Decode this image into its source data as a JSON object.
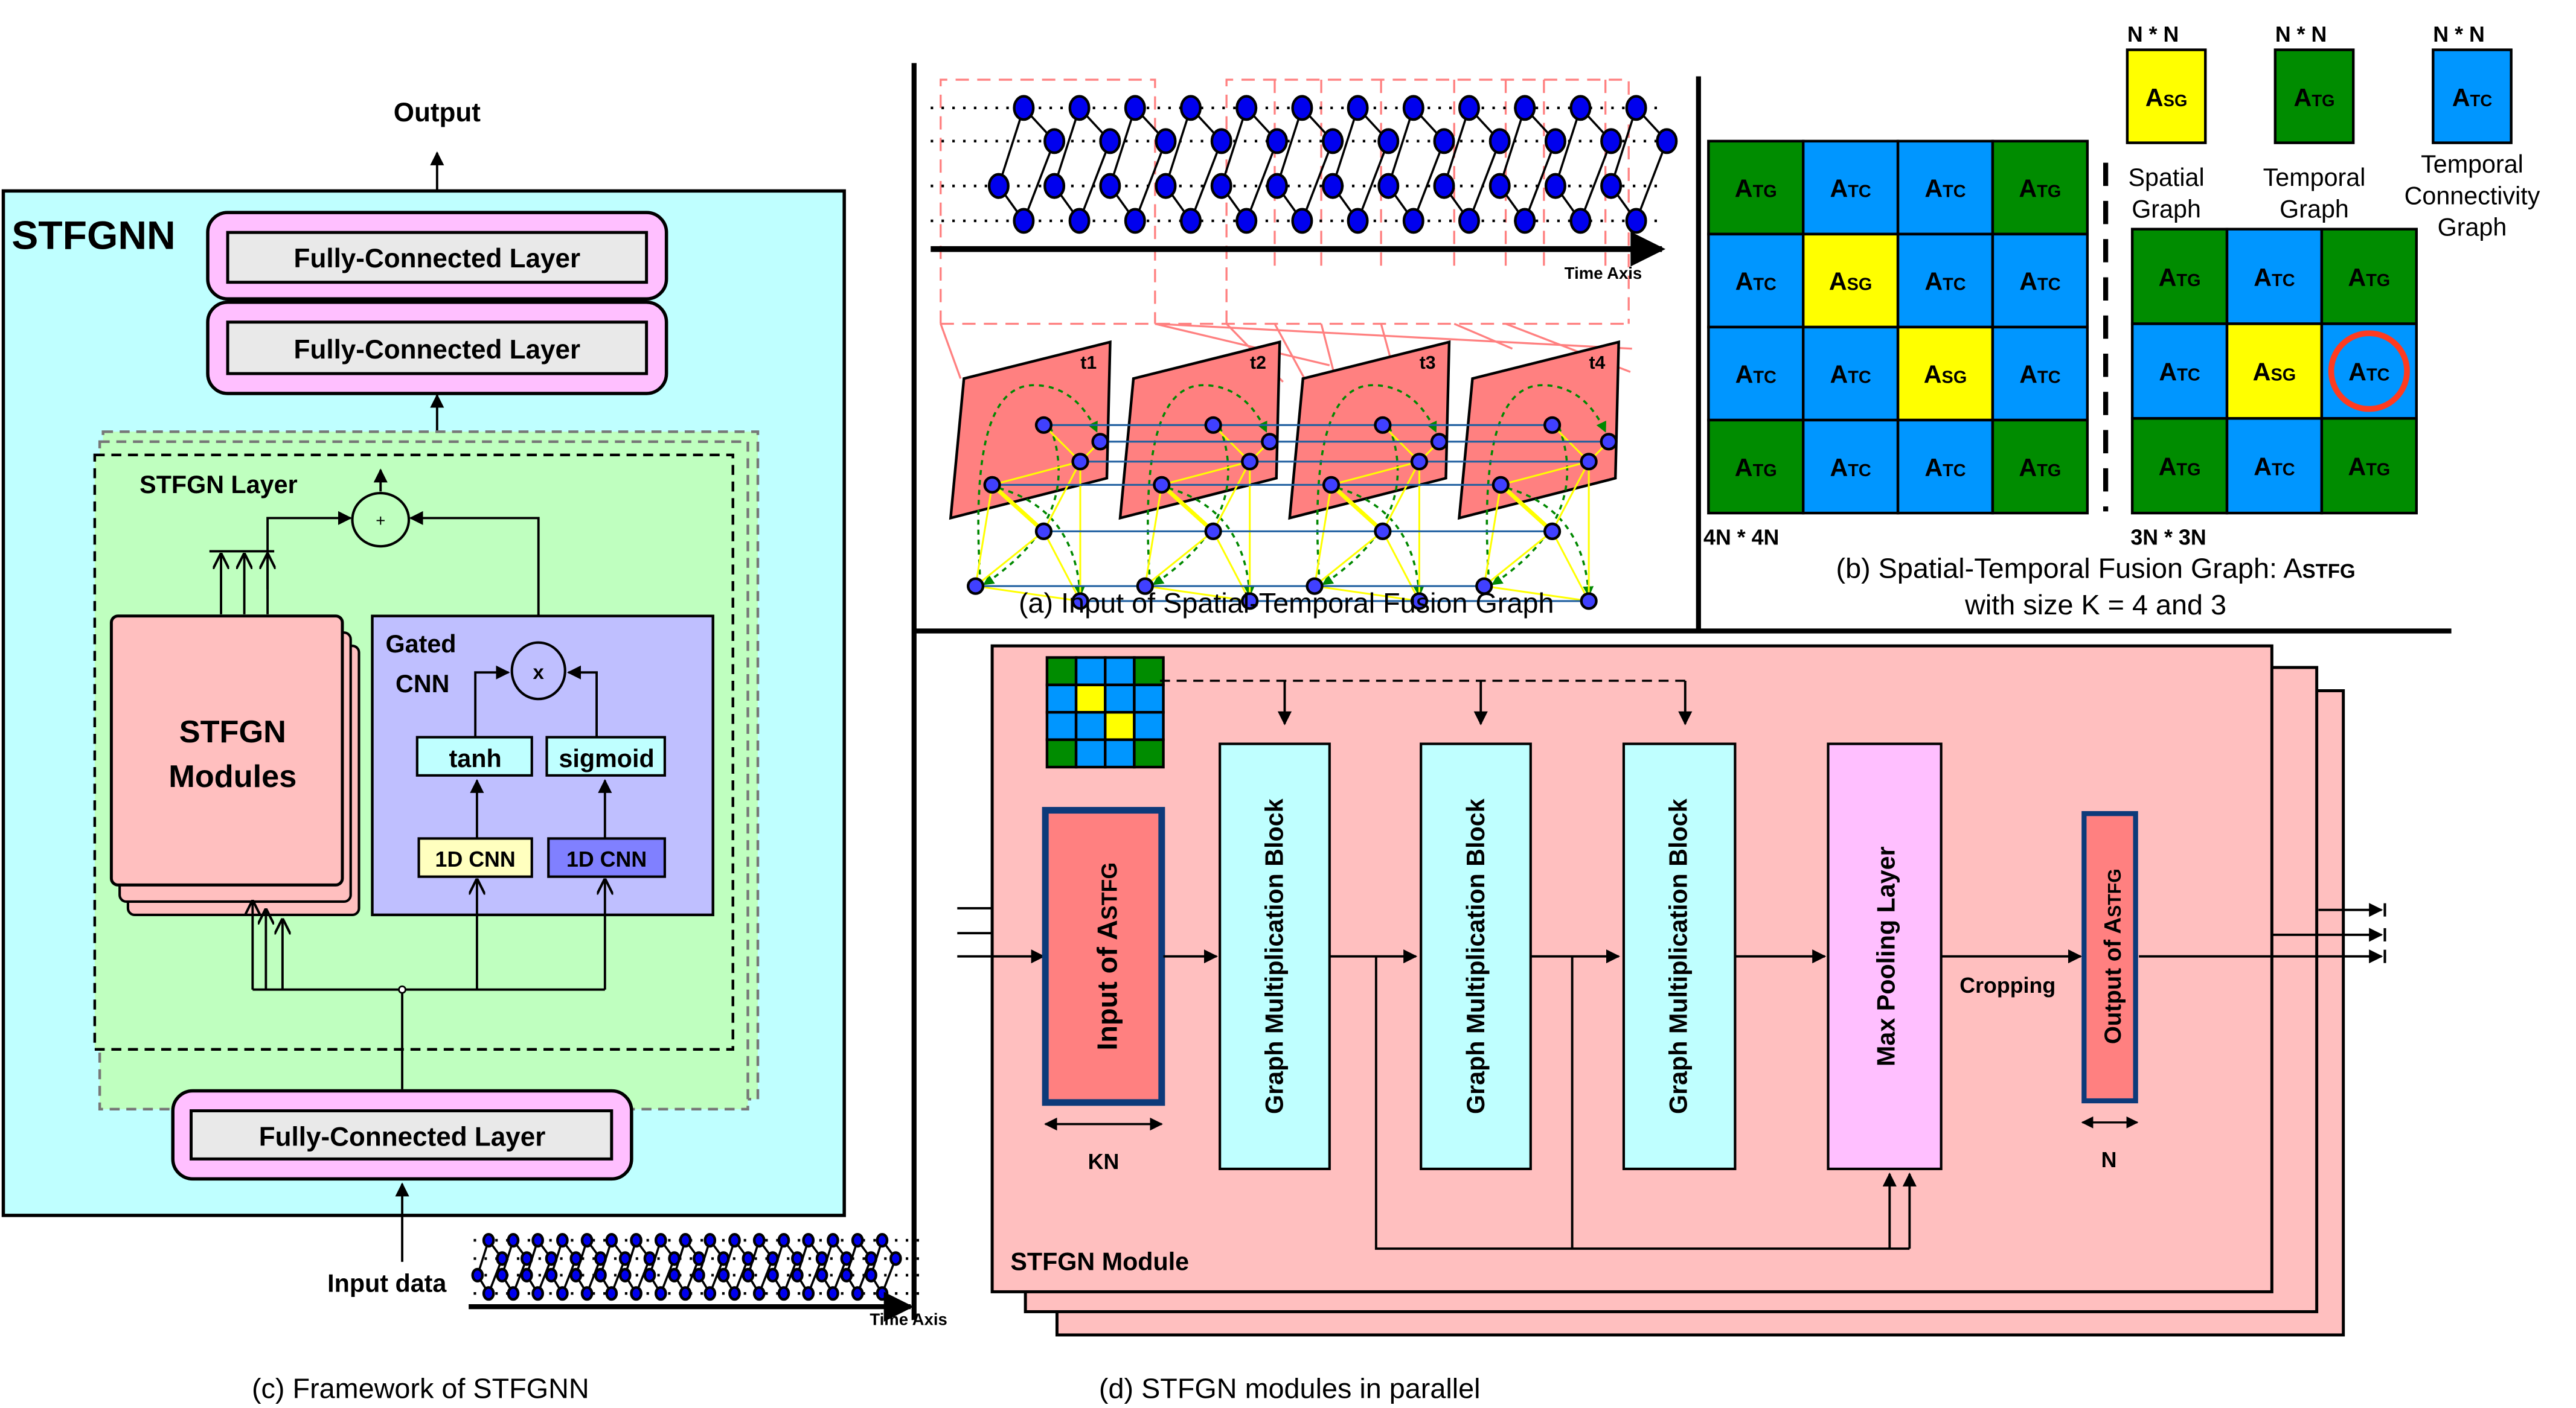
{
  "panel_c": {
    "caption": "(c) Framework of STFGNN",
    "title": "STFGNN",
    "output_label": "Output",
    "fc_top": "Fully-Connected Layer",
    "fc_mid": "Fully-Connected Layer",
    "fc_bottom": "Fully-Connected Layer",
    "stfgn_layer_label": "STFGN Layer",
    "plus_symbol": "+",
    "times_symbol": "x",
    "modules_line1": "STFGN",
    "modules_line2": "Modules",
    "gated_line1": "Gated",
    "gated_line2": "CNN",
    "tanh": "tanh",
    "sigmoid": "sigmoid",
    "cnn_left": "1D CNN",
    "cnn_right": "1D CNN",
    "input_label": "Input data",
    "time_axis": "Time Axis"
  },
  "panel_a": {
    "caption": "(a) Input of Spatial-Temporal Fusion Graph",
    "time_axis": "Time Axis",
    "planes": [
      "t1",
      "t2",
      "t3",
      "t4"
    ]
  },
  "panel_b": {
    "caption_line1_prefix": "(b) Spatial-Temporal Fusion Graph: A",
    "caption_line1_sub": "STFG",
    "caption_line2": "with size K = 4 and 3",
    "legend": [
      {
        "size": "N * N",
        "symbol": "A",
        "sub": "SG",
        "name_lines": [
          "Spatial",
          "Graph"
        ],
        "color": "#ffff00"
      },
      {
        "size": "N * N",
        "symbol": "A",
        "sub": "TG",
        "name_lines": [
          "Temporal",
          "Graph"
        ],
        "color": "#008c00"
      },
      {
        "size": "N * N",
        "symbol": "A",
        "sub": "TC",
        "name_lines": [
          "Temporal",
          "Connectivity",
          "Graph"
        ],
        "color": "#0096ff"
      }
    ],
    "matrix4": {
      "size_label": "4N * 4N",
      "cells": [
        [
          "TG",
          "TC",
          "TC",
          "TG"
        ],
        [
          "TC",
          "SG",
          "TC",
          "TC"
        ],
        [
          "TC",
          "TC",
          "SG",
          "TC"
        ],
        [
          "TG",
          "TC",
          "TC",
          "TG"
        ]
      ]
    },
    "matrix3": {
      "size_label": "3N * 3N",
      "cells": [
        [
          "TG",
          "TC",
          "TG"
        ],
        [
          "TC",
          "SG",
          "TC"
        ],
        [
          "TG",
          "TC",
          "TG"
        ]
      ],
      "highlighted_cell": [
        1,
        2
      ]
    },
    "colors": {
      "SG": "#ffff00",
      "TG": "#008c00",
      "TC": "#0096ff",
      "highlight": "#ff3b1f"
    }
  },
  "panel_d": {
    "caption": "(d) STFGN modules in parallel",
    "module_label": "STFGN Module",
    "input_block_prefix": "Input of A",
    "input_block_sub": "STFG",
    "gmb_labels": [
      "Graph Multiplication Block",
      "Graph Multiplication Block",
      "Graph Multiplication Block"
    ],
    "maxpool_label": "Max Pooling Layer",
    "cropping_label": "Cropping",
    "output_block_prefix": "Output of A",
    "output_block_sub": "STFG",
    "kn_label": "KN",
    "n_label": "N",
    "mini_matrix": [
      [
        "TG",
        "TC",
        "TC",
        "TG"
      ],
      [
        "TC",
        "SG",
        "TC",
        "TC"
      ],
      [
        "TC",
        "TC",
        "SG",
        "TC"
      ],
      [
        "TG",
        "TC",
        "TC",
        "TG"
      ]
    ]
  },
  "colors": {
    "cyan_bg": "#bfffff",
    "green_bg": "#bfffbf",
    "pink_fc": "#ffbfff",
    "grey_fc": "#e9e9e9",
    "salmon_module": "#ffbfbf",
    "salmon_dark": "#ff8080",
    "gated_bg": "#bfbfff",
    "cnn_yellow": "#ffffbf",
    "cnn_blue": "#8080ff",
    "navy_border": "#0d3a7a"
  }
}
